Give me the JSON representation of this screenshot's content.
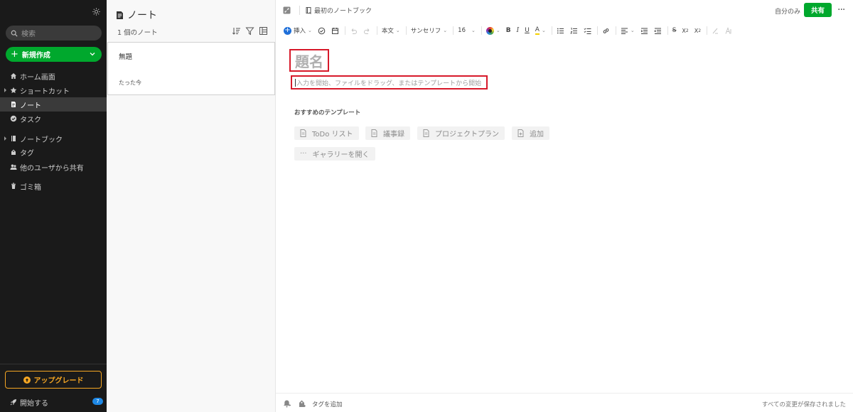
{
  "sidebar": {
    "search_placeholder": "検索",
    "new_button_label": "新規作成",
    "items": [
      {
        "label": "ホーム画面",
        "icon": "home-icon"
      },
      {
        "label": "ショートカット",
        "icon": "star-icon"
      },
      {
        "label": "ノート",
        "icon": "note-icon"
      },
      {
        "label": "タスク",
        "icon": "check-circle-icon"
      },
      {
        "label": "ノートブック",
        "icon": "notebook-icon"
      },
      {
        "label": "タグ",
        "icon": "tag-icon"
      },
      {
        "label": "他のユーザから共有",
        "icon": "people-icon"
      },
      {
        "label": "ゴミ箱",
        "icon": "trash-icon"
      }
    ],
    "active_item": "ノート",
    "upgrade_label": "アップグレード",
    "get_started_label": "開始する",
    "get_started_badge": "7"
  },
  "note_list": {
    "title": "ノート",
    "count": "1 個のノート",
    "notes": [
      {
        "title": "無題",
        "time": "たった今"
      }
    ]
  },
  "editor": {
    "notebook_name": "最初のノートブック",
    "visibility": "自分のみ",
    "share_label": "共有",
    "toolbar": {
      "insert_label": "挿入",
      "paragraph_style": "本文",
      "font_family": "サンセリフ",
      "font_size": "16"
    },
    "title_placeholder": "題名",
    "body_placeholder": "入力を開始、ファイルをドラッグ、またはテンプレートから開始",
    "templates_heading": "おすすめのテンプレート",
    "templates": [
      {
        "label": "ToDo リスト"
      },
      {
        "label": "議事録"
      },
      {
        "label": "プロジェクトプラン"
      },
      {
        "label": "追加"
      }
    ],
    "gallery_label": "ギャラリーを開く",
    "add_tag_label": "タグを追加",
    "saved_status": "すべての変更が保存されました"
  },
  "colors": {
    "accent_green": "#00a82d",
    "upgrade_orange": "#f5a623",
    "highlight_red": "#d7192a",
    "sidebar_bg": "#1a1a1a"
  }
}
